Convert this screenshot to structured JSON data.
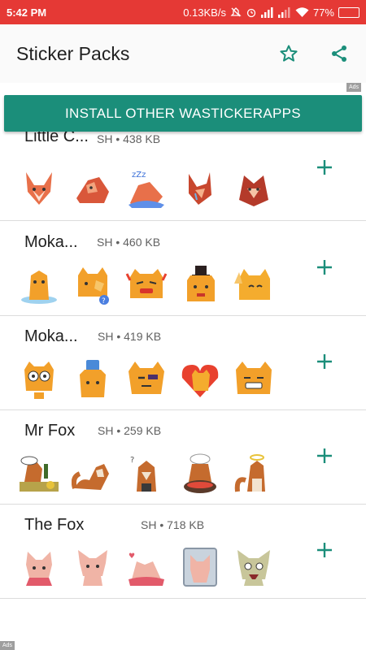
{
  "status_bar": {
    "time": "5:42 PM",
    "network_speed": "0.13KB/s",
    "battery_percent": "77%",
    "battery_level": 0.77,
    "background_color": "#e53935"
  },
  "app_bar": {
    "title": "Sticker Packs",
    "favorite_icon": "star-outline-icon",
    "share_icon": "share-icon",
    "accent_color": "#1b8e7a"
  },
  "ads": {
    "label": "Ads"
  },
  "install_button": {
    "label": "INSTALL OTHER WASTICKERAPPS"
  },
  "packs": [
    {
      "name": "Little C...",
      "meta": "SH • 438 KB",
      "character": "low-poly-fox",
      "stickers": [
        "fox-sitting",
        "fox-lying",
        "fox-sleeping-zzz",
        "fox-crying",
        "fox-peeking"
      ]
    },
    {
      "name": "Moka...",
      "meta": "SH • 460 KB",
      "character": "orange-cat",
      "stickers": [
        "cat-melting",
        "cat-facepalm",
        "cat-angry",
        "cat-top-hat",
        "cat-waving"
      ]
    },
    {
      "name": "Moka...",
      "meta": "SH • 419 KB",
      "character": "orange-cat-2",
      "stickers": [
        "cat-shocked",
        "cat-coffee",
        "cat-bored",
        "cat-heart",
        "cat-grinning"
      ]
    },
    {
      "name": "Mr Fox",
      "meta": "SH • 259 KB",
      "character": "brown-fox",
      "stickers": [
        "fox-party",
        "fox-lounging",
        "fox-thinking",
        "fox-chef",
        "fox-angel"
      ]
    },
    {
      "name": "The Fox",
      "meta": "SH • 718 KB",
      "character": "pink-fox",
      "stickers": [
        "pink-fox-shy",
        "pink-fox-sitting",
        "pink-fox-sleeping",
        "pink-fox-window",
        "pink-fox-zombie"
      ]
    }
  ]
}
